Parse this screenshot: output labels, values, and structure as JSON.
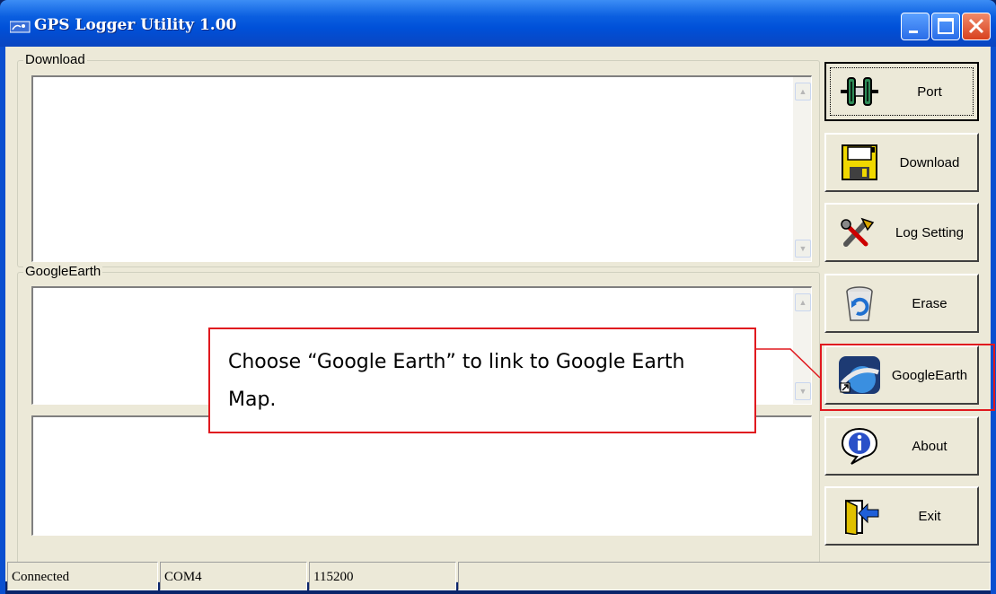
{
  "window": {
    "title": "GPS Logger Utility 1.00",
    "icon": "satellite-icon"
  },
  "groups": {
    "download_label": "Download",
    "googleearth_label": "GoogleEarth"
  },
  "buttons": [
    {
      "id": "port",
      "label": "Port",
      "icon": "port-connector-icon"
    },
    {
      "id": "download",
      "label": "Download",
      "icon": "floppy-disk-icon"
    },
    {
      "id": "log_setting",
      "label": "Log Setting",
      "icon": "tools-icon"
    },
    {
      "id": "erase",
      "label": "Erase",
      "icon": "recycle-bin-icon"
    },
    {
      "id": "googleearth",
      "label": "GoogleEarth",
      "icon": "google-earth-icon"
    },
    {
      "id": "about",
      "label": "About",
      "icon": "info-icon"
    },
    {
      "id": "exit",
      "label": "Exit",
      "icon": "exit-door-icon"
    }
  ],
  "status": {
    "connection": "Connected",
    "port": "COM4",
    "baud": "115200"
  },
  "callout": {
    "text": "Choose “Google Earth” to link to Google Earth Map."
  },
  "colors": {
    "callout_border": "#e0191f",
    "titlebar": "#0050d8",
    "face": "#ece9d8"
  }
}
